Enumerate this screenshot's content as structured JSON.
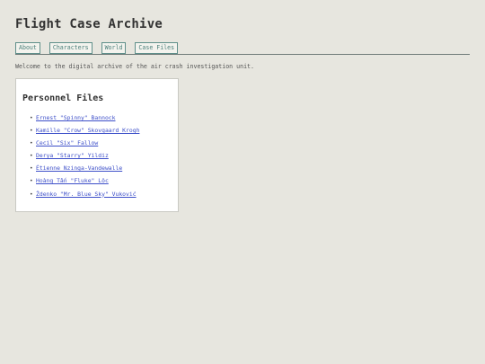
{
  "header": {
    "title": "Flight Case Archive"
  },
  "nav": {
    "items": [
      {
        "label": "About"
      },
      {
        "label": "Characters"
      },
      {
        "label": "World"
      },
      {
        "label": "Case Files"
      }
    ]
  },
  "main": {
    "welcome_text": "Welcome to the digital archive of the air crash investigation unit.",
    "personnel": {
      "title": "Personnel Files",
      "items": [
        {
          "name": "Ernest \"Spinny\" Bannock"
        },
        {
          "name": "Kamille \"Crow\" Skovgaard Krogh"
        },
        {
          "name": "Cecil \"Six\" Fallow"
        },
        {
          "name": "Derya \"Starry\" Yildiz"
        },
        {
          "name": "Étienne Nzinga-Vandewalle"
        },
        {
          "name": "Hoàng Tấn \"Fluke\" Lộc"
        },
        {
          "name": "Ždenko \"Mr. Blue Sky\" Vuković"
        }
      ]
    }
  },
  "colors": {
    "background": "#e7e6df",
    "nav_border": "#5f8f8a",
    "link": "#3d4fc9"
  }
}
